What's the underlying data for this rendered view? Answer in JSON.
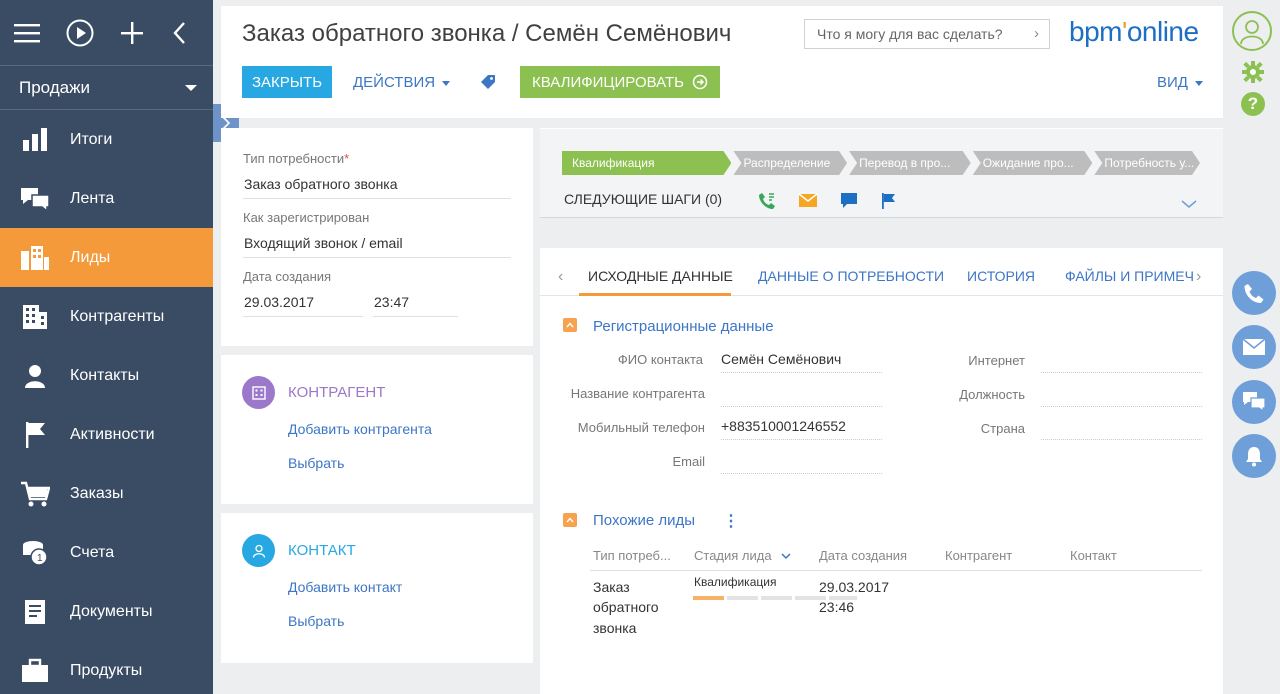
{
  "sidebar": {
    "section": "Продажи",
    "items": [
      {
        "label": "Итоги",
        "icon": "bar-chart-icon"
      },
      {
        "label": "Лента",
        "icon": "chat-icon"
      },
      {
        "label": "Лиды",
        "icon": "leads-icon",
        "active": true
      },
      {
        "label": "Контрагенты",
        "icon": "building-icon"
      },
      {
        "label": "Контакты",
        "icon": "person-icon"
      },
      {
        "label": "Активности",
        "icon": "flag-icon"
      },
      {
        "label": "Заказы",
        "icon": "cart-icon"
      },
      {
        "label": "Счета",
        "icon": "coins-icon"
      },
      {
        "label": "Документы",
        "icon": "document-icon"
      },
      {
        "label": "Продукты",
        "icon": "briefcase-icon"
      }
    ]
  },
  "header": {
    "title": "Заказ обратного звонка / Семён Семёнович",
    "search_placeholder": "Что я могу для вас сделать?",
    "logo_prefix": "bpm",
    "logo_mark": "'",
    "logo_suffix": "online",
    "close_label": "ЗАКРЫТЬ",
    "actions_label": "ДЕЙСТВИЯ",
    "qualify_label": "КВАЛИФИЦИРОВАТЬ",
    "view_label": "ВИД"
  },
  "info": {
    "need_type_label": "Тип потребности",
    "need_type_value": "Заказ обратного звонка",
    "registered_label": "Как зарегистрирован",
    "registered_value": "Входящий звонок / email",
    "created_label": "Дата создания",
    "created_date": "29.03.2017",
    "created_time": "23:47"
  },
  "counterparty": {
    "title": "КОНТРАГЕНТ",
    "add_link": "Добавить контрагента",
    "select_link": "Выбрать"
  },
  "contact": {
    "title": "КОНТАКТ",
    "add_link": "Добавить контакт",
    "select_link": "Выбрать"
  },
  "stages": [
    {
      "label": "Квалификация",
      "active": true
    },
    {
      "label": "Распределение",
      "active": false
    },
    {
      "label": "Перевод в про...",
      "active": false
    },
    {
      "label": "Ожидание про...",
      "active": false
    },
    {
      "label": "Потребность у...",
      "active": false
    }
  ],
  "next_steps_label": "СЛЕДУЮЩИЕ ШАГИ (0)",
  "tabs": [
    "ИСХОДНЫЕ ДАННЫЕ",
    "ДАННЫЕ О ПОТРЕБНОСТИ",
    "ИСТОРИЯ",
    "ФАЙЛЫ И ПРИМЕЧ"
  ],
  "registration": {
    "title": "Регистрационные данные",
    "contact_name_label": "ФИО контакта",
    "contact_name_value": "Семён Семёнович",
    "account_name_label": "Название контрагента",
    "mobile_label": "Мобильный телефон",
    "mobile_value": "+883510001246552",
    "email_label": "Email",
    "internet_label": "Интернет",
    "position_label": "Должность",
    "country_label": "Страна"
  },
  "similar": {
    "title": "Похожие лиды",
    "columns": [
      "Тип потреб...",
      "Стадия лида",
      "Дата создания",
      "Контрагент",
      "Контакт"
    ],
    "row": {
      "type_line1": "Заказ",
      "type_line2": "обратного",
      "type_line3": "звонка",
      "stage": "Квалификация",
      "date": "29.03.2017",
      "time": "23:46"
    }
  },
  "colors": {
    "sidebar": "#3a4c63",
    "accent_orange": "#f59a3a",
    "accent_blue": "#28a8e2",
    "accent_green": "#8cc152",
    "link": "#3c76c5"
  }
}
